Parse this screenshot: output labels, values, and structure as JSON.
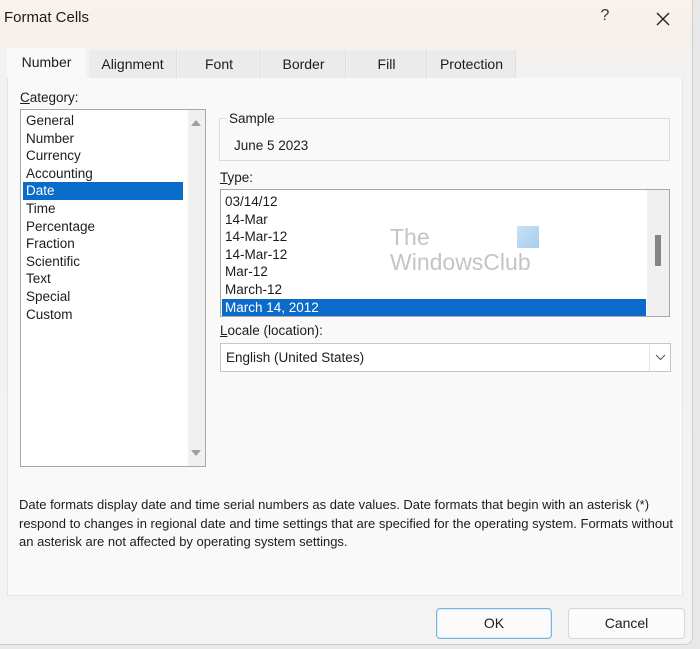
{
  "window": {
    "title": "Format Cells",
    "help_label": "?",
    "close_icon": "close-icon"
  },
  "tabs": [
    {
      "label": "Number",
      "active": true
    },
    {
      "label": "Alignment",
      "active": false
    },
    {
      "label": "Font",
      "active": false
    },
    {
      "label": "Border",
      "active": false
    },
    {
      "label": "Fill",
      "active": false
    },
    {
      "label": "Protection",
      "active": false
    }
  ],
  "category": {
    "label_accel": "C",
    "label_rest": "ategory:",
    "items": [
      "General",
      "Number",
      "Currency",
      "Accounting",
      "Date",
      "Time",
      "Percentage",
      "Fraction",
      "Scientific",
      "Text",
      "Special",
      "Custom"
    ],
    "selected": "Date"
  },
  "sample": {
    "label": "Sample",
    "value": "June 5 2023"
  },
  "type": {
    "label_accel": "T",
    "label_rest": "ype:",
    "items": [
      "03/14/12",
      "14-Mar",
      "14-Mar-12",
      "14-Mar-12",
      "Mar-12",
      "March-12",
      "March 14, 2012"
    ],
    "selected": "March 14, 2012"
  },
  "locale": {
    "label_accel": "L",
    "label_rest": "ocale (location):",
    "value": "English (United States)"
  },
  "watermark": {
    "line1": "The",
    "line2": "WindowsClub"
  },
  "description": "Date formats display date and time serial numbers as date values.  Date formats that begin with an asterisk (*) respond to changes in regional date and time settings that are specified for the operating system. Formats without an asterisk are not affected by operating system settings.",
  "buttons": {
    "ok": "OK",
    "cancel": "Cancel"
  },
  "colors": {
    "selection": "#0a6bcb",
    "default_button_border": "#7eb4d8"
  }
}
